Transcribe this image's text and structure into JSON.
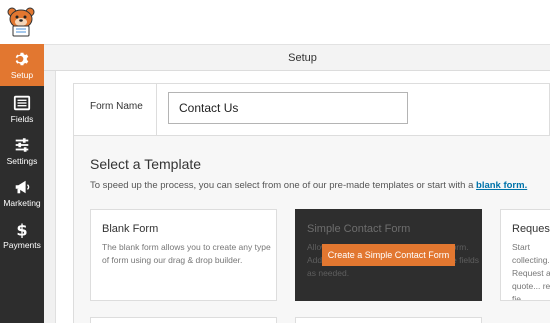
{
  "header": {
    "title": "Setup"
  },
  "sidebar": {
    "items": [
      {
        "label": "Setup",
        "icon": "gear-icon",
        "active": true
      },
      {
        "label": "Fields",
        "icon": "fields-list-icon"
      },
      {
        "label": "Settings",
        "icon": "sliders-icon"
      },
      {
        "label": "Marketing",
        "icon": "megaphone-icon"
      },
      {
        "label": "Payments",
        "icon": "dollar-icon"
      }
    ]
  },
  "form_name": {
    "label": "Form Name",
    "value": "Contact Us"
  },
  "templates": {
    "title": "Select a Template",
    "description": "To speed up the process, you can select from one of our pre-made templates or start with a",
    "blank_link": "blank form.",
    "cards": [
      {
        "title": "Blank Form",
        "description": "The blank form allows you to create any type of form using our drag & drop builder."
      },
      {
        "title": "Simple Contact Form",
        "description": "Allows you to create a simple contact form. Add fields, change the layout or remove fields as needed.",
        "button": "Create a Simple Contact Form"
      },
      {
        "title": "Request",
        "description": "Start collecting... Request a quote... remove fie..."
      }
    ]
  },
  "colors": {
    "accent": "#e27730",
    "sidebar": "#2d2d2d",
    "link": "#0073aa"
  }
}
